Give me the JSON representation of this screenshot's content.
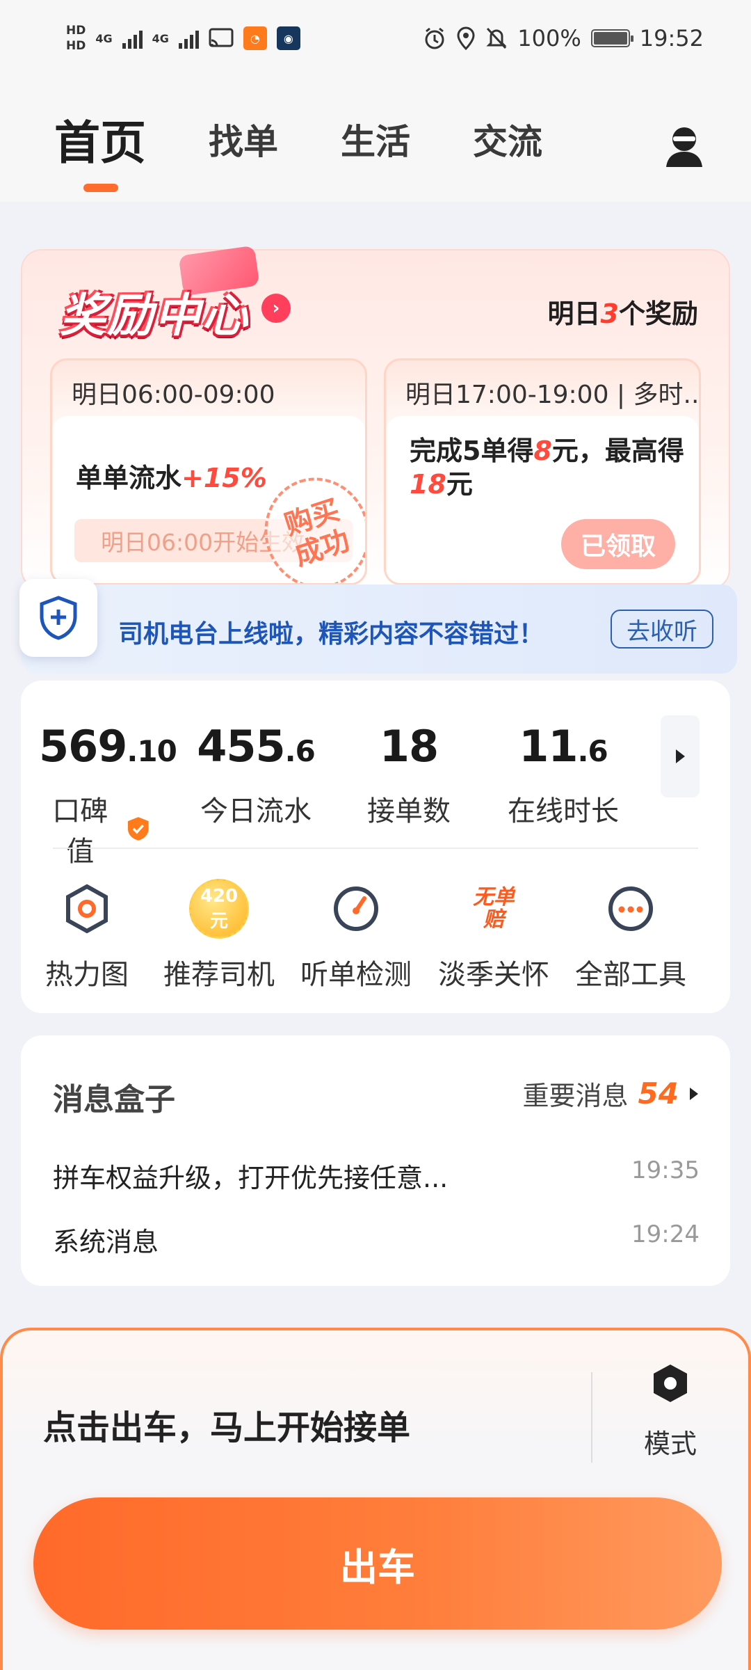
{
  "status_bar": {
    "hd1": "HD",
    "hd2": "HD",
    "net1": "4G",
    "net2": "4G",
    "battery": "100%",
    "time": "19:52"
  },
  "nav": {
    "tabs": [
      "首页",
      "找单",
      "生活",
      "交流"
    ],
    "active_tab": "首页"
  },
  "rewards": {
    "title": "奖励中心",
    "summary_prefix": "明日",
    "summary_count": "3",
    "summary_suffix": "个奖励",
    "card1": {
      "time": "明日06:00-09:00",
      "main_prefix": "单单流水",
      "main_highlight": "+15%",
      "bar_text": "明日06:00开始生效",
      "stamp": "购买成功"
    },
    "card2": {
      "time": "明日17:00-19:00 | 多时...",
      "line_a": "完成5单得",
      "amount_a": "8",
      "line_b": "元，最高得",
      "amount_b": "18",
      "line_c": "元",
      "button": "已领取"
    }
  },
  "radio_banner": {
    "text": "司机电台上线啦，精彩内容不容错过！",
    "button": "去收听"
  },
  "stats": {
    "items": [
      {
        "int": "569",
        "dec": ".10",
        "label": "口碑值"
      },
      {
        "int": "455",
        "dec": ".6",
        "label": "今日流水"
      },
      {
        "int": "18",
        "dec": "",
        "label": "接单数"
      },
      {
        "int": "11",
        "dec": ".6",
        "label": "在线时长"
      }
    ]
  },
  "tools": [
    {
      "label": "热力图",
      "icon": "hexagon-icon"
    },
    {
      "label": "推荐司机",
      "icon": "coin-icon",
      "coin_text": "420元"
    },
    {
      "label": "听单检测",
      "icon": "gauge-icon"
    },
    {
      "label": "淡季关怀",
      "icon": "no-order-compensation-icon",
      "badge_line1": "无单",
      "badge_line2": "赔"
    },
    {
      "label": "全部工具",
      "icon": "more-icon"
    }
  ],
  "messages": {
    "title": "消息盒子",
    "important_label": "重要消息",
    "important_count": "54",
    "rows": [
      {
        "text": "拼车权益升级，打开优先接任意...",
        "time": "19:35"
      },
      {
        "text": "系统消息",
        "time": "19:24"
      }
    ]
  },
  "bottom": {
    "prompt": "点击出车，马上开始接单",
    "mode_label": "模式",
    "go_button": "出车"
  },
  "colors": {
    "accent": "#ff6d2e",
    "highlight_red": "#ff4a3d",
    "banner_blue": "#1d55b8"
  }
}
